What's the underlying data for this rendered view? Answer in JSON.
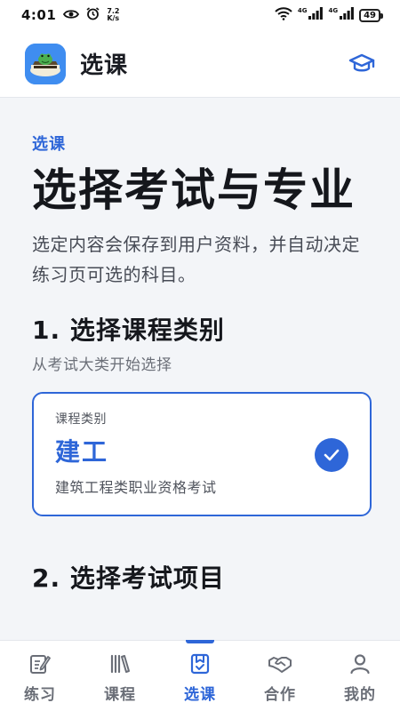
{
  "status_bar": {
    "time": "4:01",
    "speed_value": "7.2",
    "speed_unit": "K/s",
    "network_1": "4G",
    "network_2": "4G",
    "battery": "49"
  },
  "header": {
    "title": "选课",
    "logo_icon": "app-logo-icon",
    "action_icon": "graduation-cap-icon"
  },
  "main": {
    "eyebrow": "选课",
    "title": "选择考试与专业",
    "intro": "选定内容会保存到用户资料，并自动决定练习页可选的科目。",
    "step1": {
      "title": "1. 选择课程类别",
      "subtitle": "从考试大类开始选择",
      "card": {
        "label": "课程类别",
        "value": "建工",
        "description": "建筑工程类职业资格考试",
        "selected": true
      }
    },
    "step2": {
      "title": "2. 选择考试项目"
    }
  },
  "bottom_nav": {
    "items": [
      {
        "label": "练习",
        "icon": "edit-note-icon",
        "active": false
      },
      {
        "label": "课程",
        "icon": "books-icon",
        "active": false
      },
      {
        "label": "选课",
        "icon": "bookmark-check-icon",
        "active": true
      },
      {
        "label": "合作",
        "icon": "handshake-icon",
        "active": false
      },
      {
        "label": "我的",
        "icon": "person-icon",
        "active": false
      }
    ]
  },
  "colors": {
    "accent": "#2e66d8",
    "background": "#f3f5f8",
    "text": "#15171c",
    "muted": "#6a6e77"
  }
}
